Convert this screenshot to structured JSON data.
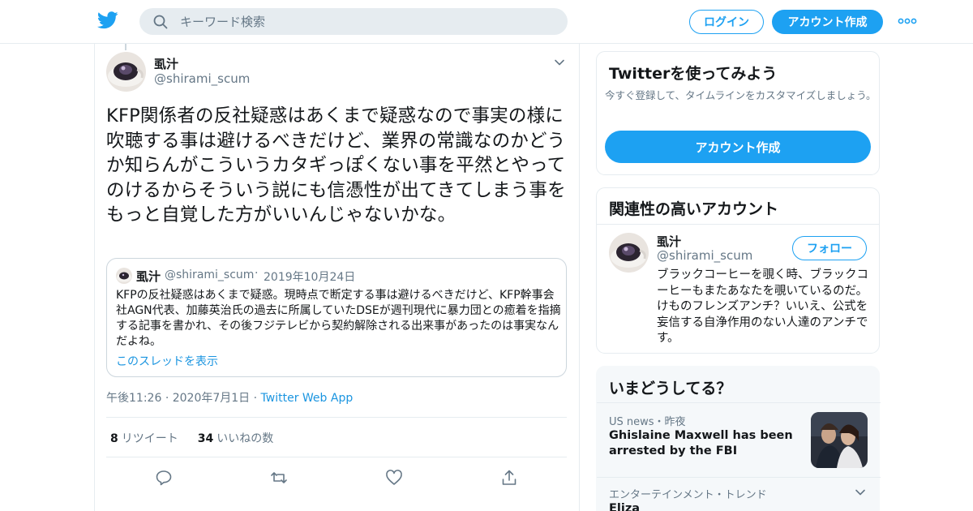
{
  "header": {
    "search_placeholder": "キーワード検索",
    "login_label": "ログイン",
    "signup_label": "アカウント作成"
  },
  "tweet": {
    "author_name": "虱汁",
    "author_handle": "@shirami_scum",
    "text": "KFP関係者の反社疑惑はあくまで疑惑なので事実の様に吹聴する事は避けるべきだけど、業界の常識なのかどうか知らんがこういうカタギっぽくない事を平然とやってのけるからそういう説にも信憑性が出てきてしまう事をもっと自覚した方がいいんじゃないかな。",
    "time": "午後11:26",
    "date": "2020年7月1日",
    "via": "Twitter Web App",
    "retweet_count": "8",
    "retweet_label": "リツイート",
    "like_count": "34",
    "like_label": "いいねの数"
  },
  "quoted": {
    "author_name": "虱汁",
    "author_handle": "@shirami_scum",
    "separator": "·",
    "date": "2019年10月24日",
    "text": "KFPの反社疑惑はあくまで疑惑。現時点で断定する事は避けるべきだけど、KFP幹事会社AGN代表、加藤英治氏の過去に所属していたDSEが週刊現代に暴力団との癒着を指摘する記事を書かれ、その後フジテレビから契約解除される出来事があったのは事実なんだよね。",
    "thread_link": "このスレッドを表示"
  },
  "sidebar": {
    "try_title": "Twitterを使ってみよう",
    "try_sub": "今すぐ登録して、タイムラインをカスタマイズしましょう。",
    "try_button": "アカウント作成",
    "related_title": "関連性の高いアカウント",
    "related": {
      "name": "虱汁",
      "handle": "@shirami_scum",
      "follow_label": "フォロー",
      "bio": "ブラックコーヒーを覗く時、ブラックコーヒーもまたあなたを覗いているのだ。 けものフレンズアンチ？いいえ、公式を妄信する自浄作用のない人達のアンチです。"
    },
    "trends_title": "いまどうしてる？",
    "trends": [
      {
        "meta": "US news・昨夜",
        "title": "Ghislaine Maxwell has been arrested by the FBI"
      },
      {
        "meta": "エンターテインメント・トレンド",
        "title": "Eliza"
      }
    ]
  },
  "colors": {
    "accent": "#1da1f2",
    "link": "#1b95e0",
    "secondary_text": "#657786",
    "border": "#e6ecf0"
  },
  "icons": [
    "twitter-bird-icon",
    "search-icon",
    "more-dots-icon",
    "chevron-down-icon",
    "reply-icon",
    "retweet-icon",
    "like-icon",
    "share-icon"
  ]
}
